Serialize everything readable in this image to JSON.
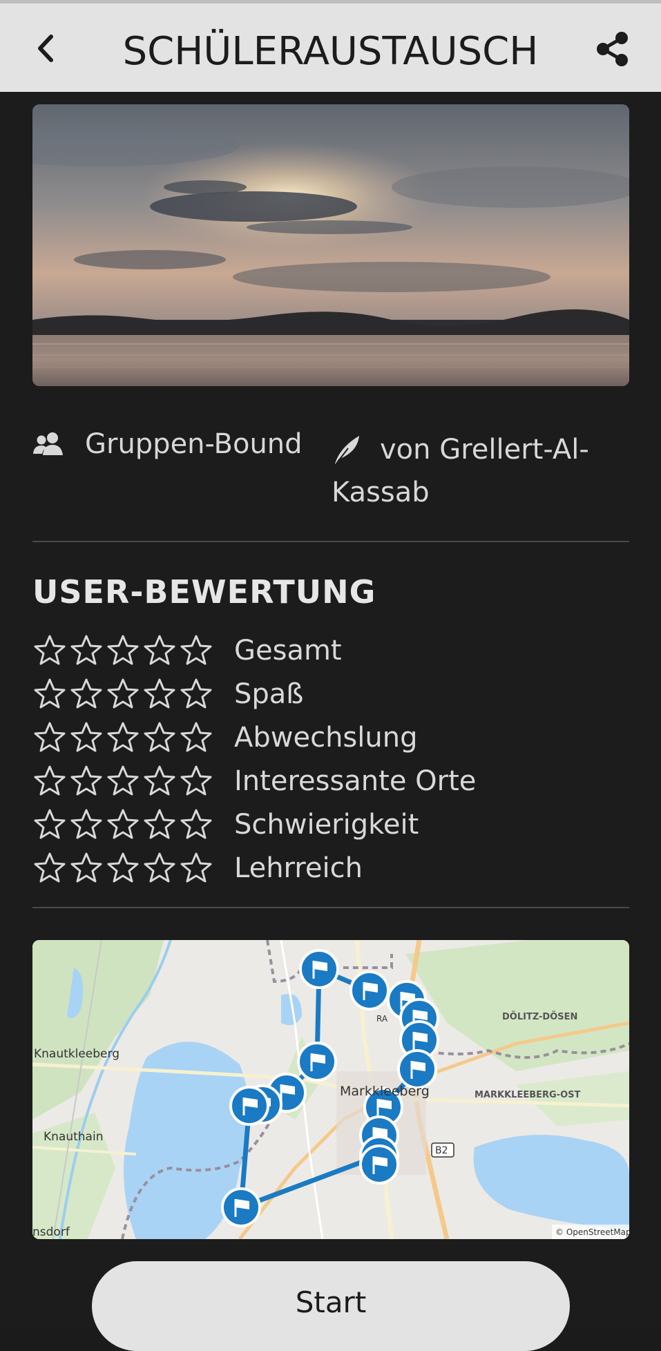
{
  "header": {
    "title": "SCHÜLERAUSTAUSCH",
    "back_icon": "chevron-left-icon",
    "share_icon": "share-icon"
  },
  "meta": {
    "group_icon": "group-icon",
    "group_label": "Gruppen-Bound",
    "author_icon": "feather-icon",
    "author_label": "von Grellert-Al-Kassab"
  },
  "rating": {
    "title": "USER-BEWERTUNG",
    "items": [
      {
        "label": "Gesamt",
        "stars": 0,
        "max": 5
      },
      {
        "label": "Spaß",
        "stars": 0,
        "max": 5
      },
      {
        "label": "Abwechslung",
        "stars": 0,
        "max": 5
      },
      {
        "label": "Interessante Orte",
        "stars": 0,
        "max": 5
      },
      {
        "label": "Schwierigkeit",
        "stars": 0,
        "max": 5
      },
      {
        "label": "Lehrreich",
        "stars": 0,
        "max": 5
      }
    ]
  },
  "map": {
    "labels": [
      "Knautkleeberg",
      "Knauthain",
      "Markkleeberg",
      "MARKKLEEBERG-OST",
      "DÖLITZ-DÖSEN",
      "B2",
      "nsdorf",
      "RA"
    ],
    "attribution": "© OpenStreetMap",
    "marker_icon": "flag-marker-icon"
  },
  "actions": {
    "start_label": "Start"
  },
  "colors": {
    "header_bg": "#e3e3e3",
    "page_bg": "#1c1c1c",
    "marker": "#1a7ac4",
    "water": "#a9d3f5"
  }
}
